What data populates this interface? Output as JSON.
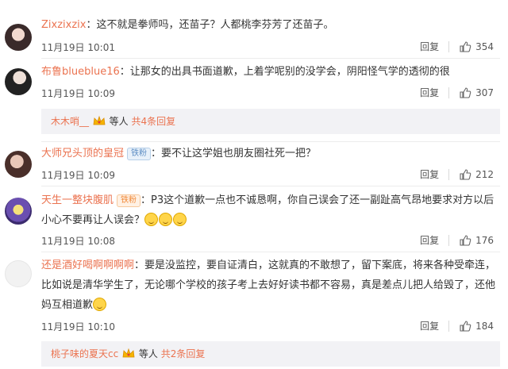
{
  "comments": [
    {
      "user": "Zixzixzix",
      "text": "：这不就是拳师吗，还苗子？人都桃李芬芳了还苗子。",
      "date": "11月19日",
      "time": "10:01",
      "reply_label": "回复",
      "likes": "354"
    },
    {
      "user": "布鲁blueblue16",
      "text": "：让那女的出具书面道歉，上着学呢别的没学会，阴阳怪气学的透彻的很",
      "date": "11月19日",
      "time": "10:09",
      "reply_label": "回复",
      "likes": "307",
      "sub": {
        "user": "木木哨__",
        "suffix": "等人",
        "more": "共4条回复"
      }
    },
    {
      "user": "大师兄头顶的皇冠",
      "badge": "铁粉",
      "text": "：要不让这学姐也朋友圈社死一把？",
      "date": "11月19日",
      "time": "10:09",
      "reply_label": "回复",
      "likes": "212"
    },
    {
      "user": "天生一整块腹肌",
      "badge": "铁粉",
      "text": "：P3这个道歉一点也不诚恳啊，你自己误会了还一副趾高气昂地要求对方以后小心不要再让人误会？",
      "date": "11月19日",
      "time": "10:08",
      "reply_label": "回复",
      "likes": "176"
    },
    {
      "user": "还是酒好喝啊啊啊啊",
      "text": "：要是没监控，要自证清白，这就真的不敢想了，留下案底，将来各种受牵连，比如说是清华学生了，无论哪个学校的孩子考上去好好读书都不容易，真是差点儿把人给毁了，还他妈互相道歉",
      "date": "11月19日",
      "time": "10:10",
      "reply_label": "回复",
      "likes": "184",
      "sub": {
        "user": "桃子味的夏天cc",
        "suffix": "等人",
        "more": "共2条回复"
      }
    }
  ],
  "colors": {
    "username": "#eb7350",
    "text": "#333333",
    "meta": "#555555",
    "subbar_bg": "#f2f2f5"
  },
  "icons": {
    "like": "thumbs-up-icon",
    "emoji": "smile-emoji-icon",
    "crown": "crown-badge-icon"
  }
}
